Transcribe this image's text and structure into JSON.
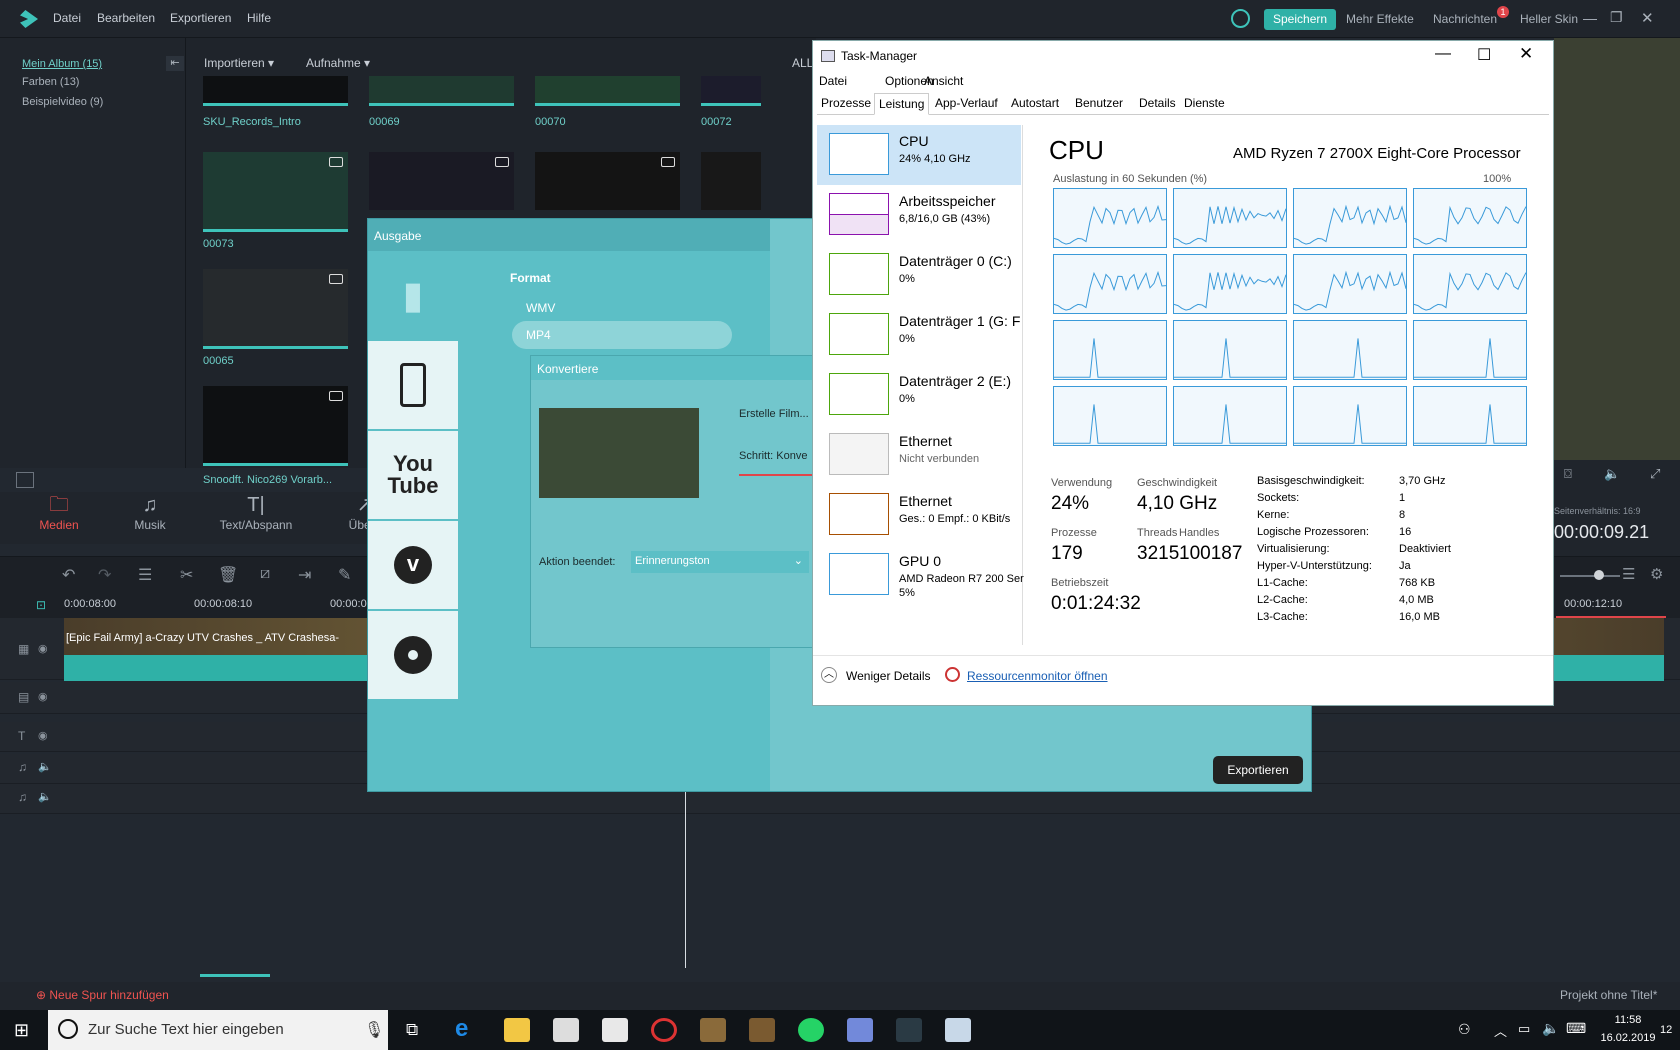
{
  "topbar": {
    "menu": [
      "Datei",
      "Bearbeiten",
      "Exportieren",
      "Hilfe"
    ],
    "save_label": "Speichern",
    "more_effects": "Mehr Effekte",
    "notifications": "Nachrichten",
    "notification_count": "1",
    "skin": "Heller Skin"
  },
  "library": {
    "items": [
      "Mein Album (15)",
      "Farben (13)",
      "Beispielvideo (9)"
    ]
  },
  "media": {
    "import_label": "Importieren",
    "record_label": "Aufnahme",
    "filter_label": "ALL",
    "clips": [
      "SKU_Records_Intro",
      "00069",
      "00070",
      "00072",
      "00073",
      "00065",
      "Snoodft. Nico269 Vorarb..."
    ]
  },
  "tools": [
    "Medien",
    "Musik",
    "Text/Abspann",
    "Überg"
  ],
  "preview": {
    "aspect_ratio": "Seitenverhältnis: 16:9",
    "timecode": "00:00:09.21"
  },
  "ruler": [
    "0:00:08:00",
    "00:00:08:10",
    "00:00:0",
    "00:00:12:10"
  ],
  "timeline": {
    "clip_title": "[Epic Fail Army] a-Crazy UTV Crashes _ ATV Crashesa-",
    "add_track": "Neue Spur hinzufügen",
    "project_title": "Projekt ohne Titel*"
  },
  "ausgabe": {
    "title": "Ausgabe",
    "format_heading": "Format",
    "formats": [
      "WMV",
      "MP4"
    ],
    "selected_format": "MP4",
    "export_label": "Exportieren"
  },
  "konvertiere": {
    "title": "Konvertiere",
    "status": "Erstelle Film...",
    "step": "Schritt: Konve",
    "action_label": "Aktion beendet:",
    "action_value": "Erinnerungston"
  },
  "taskmanager": {
    "title": "Task-Manager",
    "menu": [
      "Datei",
      "Optionen",
      "Ansicht"
    ],
    "tabs": [
      "Prozesse",
      "Leistung",
      "App-Verlauf",
      "Autostart",
      "Benutzer",
      "Details",
      "Dienste"
    ],
    "active_tab": "Leistung",
    "resources": [
      {
        "name": "CPU",
        "sub": "24% 4,10 GHz",
        "color": "#117dbb"
      },
      {
        "name": "Arbeitsspeicher",
        "sub": "6,8/16,0 GB (43%)",
        "color": "#8b12ae"
      },
      {
        "name": "Datenträger 0 (C:)",
        "sub": "0%",
        "color": "#4da60c"
      },
      {
        "name": "Datenträger 1 (G: F",
        "sub": "0%",
        "color": "#4da60c"
      },
      {
        "name": "Datenträger 2 (E:)",
        "sub": "0%",
        "color": "#4da60c"
      },
      {
        "name": "Ethernet",
        "sub": "Nicht verbunden",
        "color": "#a7a7a7"
      },
      {
        "name": "Ethernet",
        "sub": "Ges.: 0 Empf.: 0 KBit/s",
        "color": "#a74f01"
      },
      {
        "name": "GPU 0",
        "sub": "AMD Radeon R7 200 Ser",
        "sub2": "5%",
        "color": "#117dbb"
      }
    ],
    "heading": "CPU",
    "processor": "AMD Ryzen 7 2700X Eight-Core Processor",
    "graph_caption": "Auslastung in 60 Sekunden (%)",
    "graph_max": "100%",
    "stats": {
      "usage_label": "Verwendung",
      "usage": "24%",
      "speed_label": "Geschwindigkeit",
      "speed": "4,10 GHz",
      "processes_label": "Prozesse",
      "processes": "179",
      "threads_label": "Threads",
      "threads": "3215",
      "handles_label": "Handles",
      "handles": "100187",
      "uptime_label": "Betriebszeit",
      "uptime": "0:01:24:32"
    },
    "details": [
      [
        "Basisgeschwindigkeit:",
        "3,70 GHz"
      ],
      [
        "Sockets:",
        "1"
      ],
      [
        "Kerne:",
        "8"
      ],
      [
        "Logische Prozessoren:",
        "16"
      ],
      [
        "Virtualisierung:",
        "Deaktiviert"
      ],
      [
        "Hyper-V-Unterstützung:",
        "Ja"
      ],
      [
        "L1-Cache:",
        "768 KB"
      ],
      [
        "L2-Cache:",
        "4,0 MB"
      ],
      [
        "L3-Cache:",
        "16,0 MB"
      ]
    ],
    "fewer_details": "Weniger Details",
    "resource_monitor": "Ressourcenmonitor öffnen"
  },
  "taskbar": {
    "search_placeholder": "Zur Suche Text hier eingeben",
    "time": "11:58",
    "date": "16.02.2019",
    "notification_count": "12"
  }
}
